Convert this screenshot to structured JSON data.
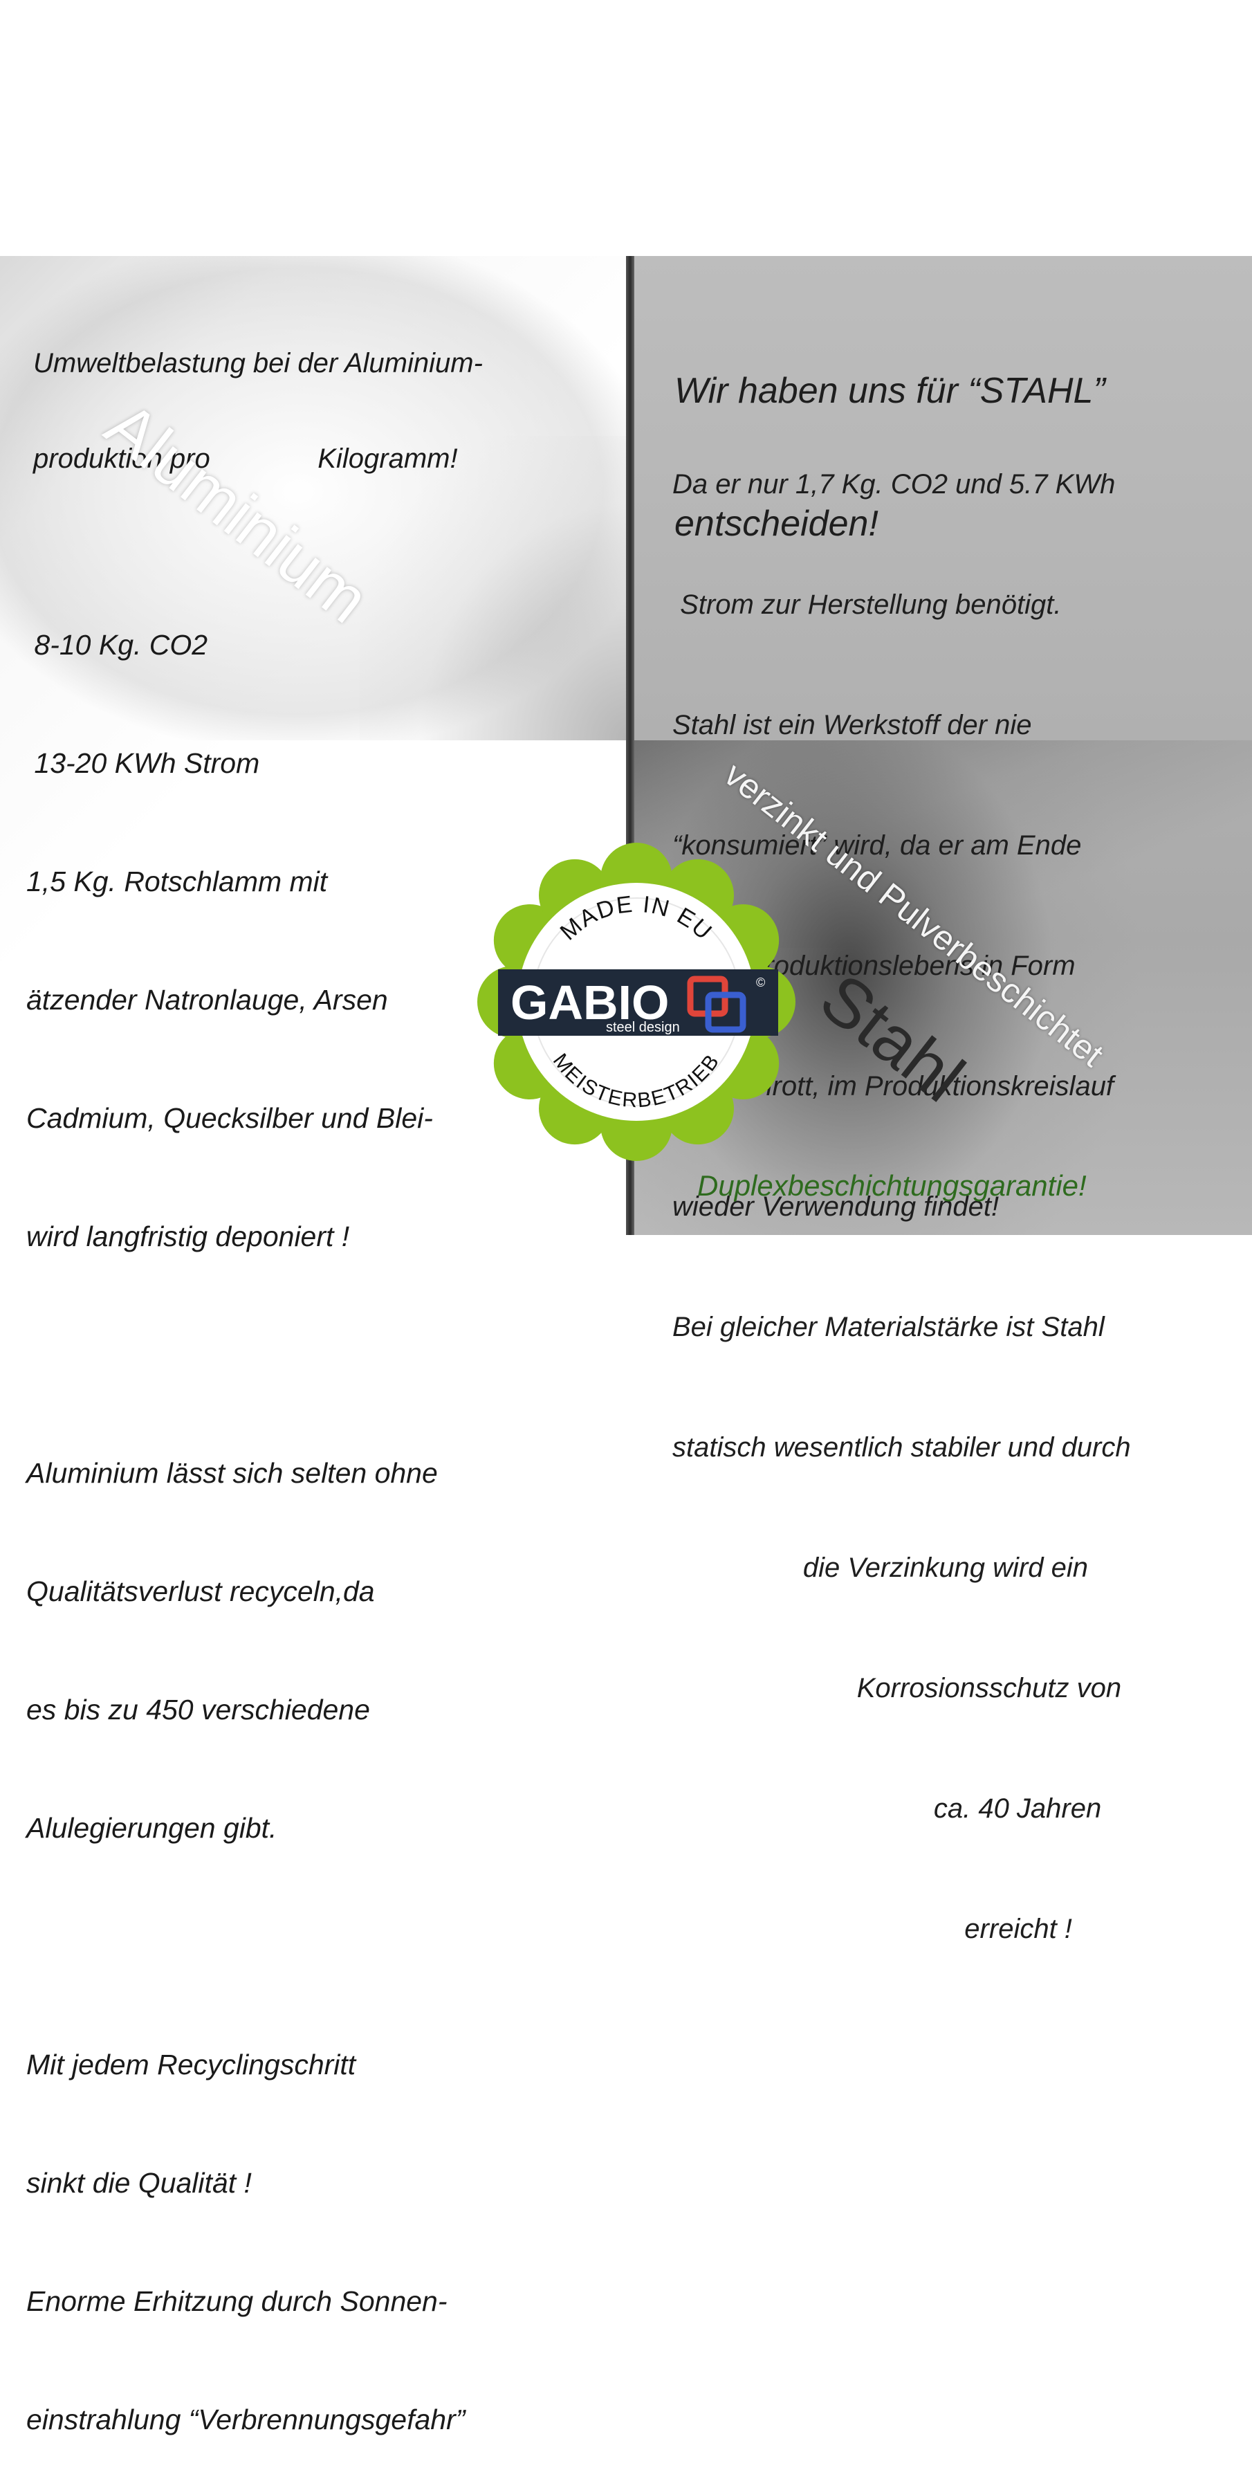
{
  "left": {
    "heading_lines": [
      "Umweltbelastung bei der Aluminium-",
      "produktion pro              Kilogramm!"
    ],
    "big_label": "Aluminium",
    "body_lines": [
      " 8-10 Kg. CO2",
      " 13-20 KWh Strom",
      "1,5 Kg. Rotschlamm mit",
      "ätzender Natronlauge, Arsen",
      "Cadmium, Quecksilber und Blei-",
      "wird langfristig deponiert !",
      "",
      "Aluminium lässt sich selten ohne",
      "Qualitätsverlust recyceln,da",
      "es bis zu 450 verschiedene",
      "Alulegierungen gibt.",
      "",
      "Mit jedem Recyclingschritt",
      "sinkt die Qualität !",
      "Enorme Erhitzung durch Sonnen-",
      "einstrahlung “Verbrennungsgefahr”"
    ]
  },
  "right": {
    "heading_lines": [
      "Wir haben uns für “STAHL”",
      "entscheiden!"
    ],
    "body_lines": [
      "Da er nur 1,7 Kg. CO2 und 5.7 KWh",
      " Strom zur Herstellung benötigt.",
      "Stahl ist ein Werkstoff der nie",
      "“konsumiert” wird, da er am Ende",
      "eines Produktionslebens in Form",
      "von Schrott, im Produktionskreislauf",
      "wieder Verwendung findet!",
      "Bei gleicher Materialstärke ist Stahl",
      "statisch wesentlich stabiler und durch",
      "                 die Verzinkung wird ein",
      "                        Korrosionsschutz von",
      "                                  ca. 40 Jahren",
      "                                      erreicht !"
    ],
    "diagonal_label": "verzinkt und Pulverbeschichtet",
    "big_label": "Stahl",
    "footer": "Duplexbeschichtungsgarantie!"
  },
  "badge": {
    "top_text": "MADE IN EU",
    "brand": "GABIO",
    "subbrand": "steel design",
    "copyright": "©",
    "bottom_text": "MEISTERBETRIEB",
    "colors": {
      "flower": "#8dc21f",
      "ring": "#ffffff",
      "plate": "#1f2a3a",
      "logo_red": "#e0453a",
      "logo_blue": "#3a5fd0"
    }
  }
}
